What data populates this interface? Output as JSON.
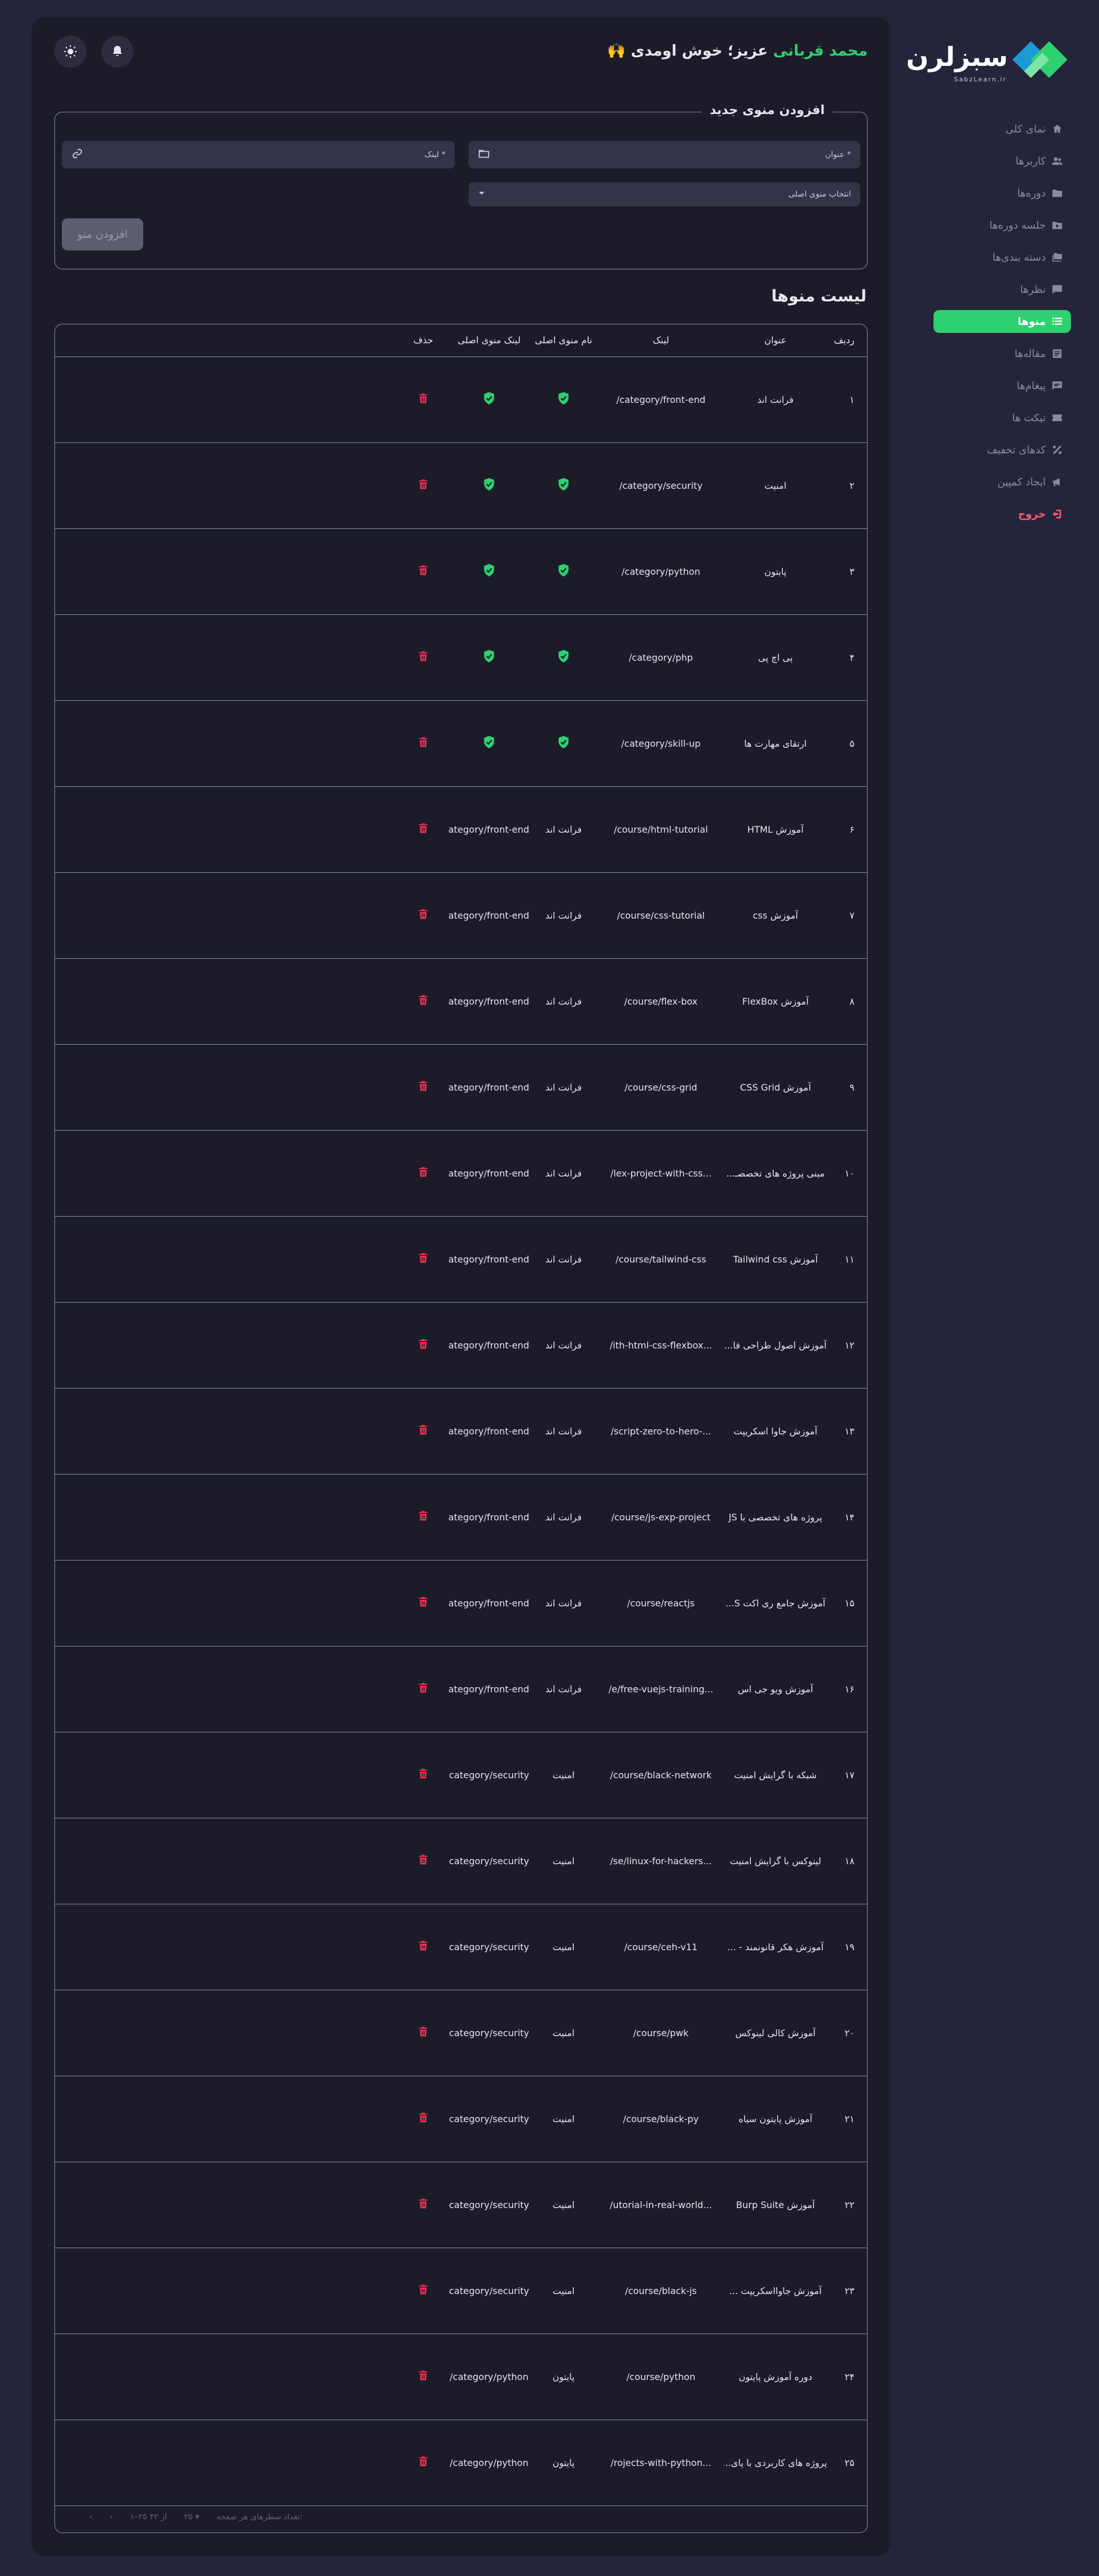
{
  "brand": {
    "name": "سبزلرن",
    "sub": "SabzLearn.ir",
    "color_green": "#2fd070",
    "color_blue": "#1c9ad6"
  },
  "header": {
    "greeting_name": "محمد قربانی",
    "greeting_text": "عزیز؛ خوش اومدی 🙌",
    "bell_icon": "bell-icon",
    "theme_icon": "sun-icon"
  },
  "sidebar": {
    "items": [
      {
        "label": "نمای کلی",
        "icon": "home-icon",
        "active": false
      },
      {
        "label": "کاربرها",
        "icon": "users-icon",
        "active": false
      },
      {
        "label": "دوره‌ها",
        "icon": "folder-icon",
        "active": false
      },
      {
        "label": "جلسه دوره‌ها",
        "icon": "folder-play-icon",
        "active": false
      },
      {
        "label": "دسته بندی‌ها",
        "icon": "folders-icon",
        "active": false
      },
      {
        "label": "نظرها",
        "icon": "comment-icon",
        "active": false
      },
      {
        "label": "منوها",
        "icon": "list-icon",
        "active": true
      },
      {
        "label": "مقاله‌ها",
        "icon": "article-icon",
        "active": false
      },
      {
        "label": "پیغام‌ها",
        "icon": "message-icon",
        "active": false
      },
      {
        "label": "تیکت ها",
        "icon": "ticket-icon",
        "active": false
      },
      {
        "label": "کدهای تخفیف",
        "icon": "percent-icon",
        "active": false
      },
      {
        "label": "ایجاد کمپین",
        "icon": "megaphone-icon",
        "active": false
      }
    ],
    "logout": "خروج"
  },
  "add_menu": {
    "title": "افزودن منوی جدید",
    "title_placeholder": "عنوان *",
    "link_placeholder": "لینک *",
    "parent_select": "انتخاب منوی اصلی",
    "submit_label": "افزودن منو"
  },
  "list": {
    "title": "لیست منوها",
    "columns": [
      "ردیف",
      "عنوان",
      "لینک",
      "نام منوی اصلی",
      "لینک منوی اصلی",
      "حذف"
    ],
    "rows": [
      {
        "n": "۱",
        "title": "فرانت اند",
        "link": "category/front-end/",
        "parent": "",
        "parent_link": ""
      },
      {
        "n": "۲",
        "title": "امنیت",
        "link": "category/security/",
        "parent": "",
        "parent_link": ""
      },
      {
        "n": "۳",
        "title": "پایتون",
        "link": "category/python/",
        "parent": "",
        "parent_link": ""
      },
      {
        "n": "۴",
        "title": "پی اچ پی",
        "link": "category/php/",
        "parent": "",
        "parent_link": ""
      },
      {
        "n": "۵",
        "title": "ارتقای مهارت ها",
        "link": "category/skill-up/",
        "parent": "",
        "parent_link": ""
      },
      {
        "n": "۶",
        "title": "آموزش HTML",
        "link": "course/html-tutorial/",
        "parent": "فرانت اند",
        "parent_link": "category/front-end/"
      },
      {
        "n": "۷",
        "title": "آموزش css",
        "link": "course/css-tutorial/",
        "parent": "فرانت اند",
        "parent_link": "category/front-end/"
      },
      {
        "n": "۸",
        "title": "آموزش FlexBox",
        "link": "course/flex-box/",
        "parent": "فرانت اند",
        "parent_link": "category/front-end/"
      },
      {
        "n": "۹",
        "title": "آموزش CSS Grid",
        "link": "course/css-grid/",
        "parent": "فرانت اند",
        "parent_link": "category/front-end/"
      },
      {
        "n": "۱۰",
        "title": "مینی پروژه های تخصصـ...",
        "link": "...lex-project-with-css/",
        "parent": "فرانت اند",
        "parent_link": "category/front-end/"
      },
      {
        "n": "۱۱",
        "title": "آموزش Tailwind css",
        "link": "course/tailwind-css/",
        "parent": "فرانت اند",
        "parent_link": "category/front-end/"
      },
      {
        "n": "۱۲",
        "title": "آموزش اصول طراحی قا...",
        "link": "...ith-html-css-flexbox/",
        "parent": "فرانت اند",
        "parent_link": "category/front-end/"
      },
      {
        "n": "۱۳",
        "title": "آموزش جاوا اسکریپت",
        "link": "...-script-zero-to-hero/",
        "parent": "فرانت اند",
        "parent_link": "category/front-end/"
      },
      {
        "n": "۱۴",
        "title": "پروژه های تخصصی با JS",
        "link": "course/js-exp-project/",
        "parent": "فرانت اند",
        "parent_link": "category/front-end/"
      },
      {
        "n": "۱۵",
        "title": "آموزش جامع ری اکت S...",
        "link": "course/reactjs/",
        "parent": "فرانت اند",
        "parent_link": "category/front-end/"
      },
      {
        "n": "۱۶",
        "title": "آموزش ویو جی اس",
        "link": "...e/free-vuejs-training/",
        "parent": "فرانت اند",
        "parent_link": "category/front-end/"
      },
      {
        "n": "۱۷",
        "title": "شبکه با گرایش امنیت",
        "link": "course/black-network/",
        "parent": "امنیت",
        "parent_link": "category/security/"
      },
      {
        "n": "۱۸",
        "title": "لینوکس با گرایش امنیت",
        "link": "...se/linux-for-hackers/",
        "parent": "امنیت",
        "parent_link": "category/security/"
      },
      {
        "n": "۱۹",
        "title": "آموزش هکر قانونمند - ...",
        "link": "course/ceh-v11/",
        "parent": "امنیت",
        "parent_link": "category/security/"
      },
      {
        "n": "۲۰",
        "title": "آموزش کالی لینوکس",
        "link": "course/pwk/",
        "parent": "امنیت",
        "parent_link": "category/security/"
      },
      {
        "n": "۲۱",
        "title": "آموزش پایتون سیاه",
        "link": "course/black-py/",
        "parent": "امنیت",
        "parent_link": "category/security/"
      },
      {
        "n": "۲۲",
        "title": "آموزش Burp Suite",
        "link": "...utorial-in-real-world/",
        "parent": "امنیت",
        "parent_link": "category/security/"
      },
      {
        "n": "۲۳",
        "title": "آموزش جاوااسکریپت ...",
        "link": "course/black-js/",
        "parent": "امنیت",
        "parent_link": "category/security/"
      },
      {
        "n": "۲۴",
        "title": "دوره آموزش پایتون",
        "link": "course/python/",
        "parent": "پایتون",
        "parent_link": "category/python/"
      },
      {
        "n": "۲۵",
        "title": "پروژه های کاربردی با پای...",
        "link": "...rojects-with-python/",
        "parent": "پایتون",
        "parent_link": "category/python/"
      }
    ]
  },
  "pagination": {
    "rows_per_page_label": "تعداد سطرهای هر صفحه:",
    "rows_per_page": "۲۵",
    "range": "۱–۲۵ از ۴۲",
    "next_icon": "chevron-right-icon",
    "prev_icon": "chevron-left-icon"
  }
}
